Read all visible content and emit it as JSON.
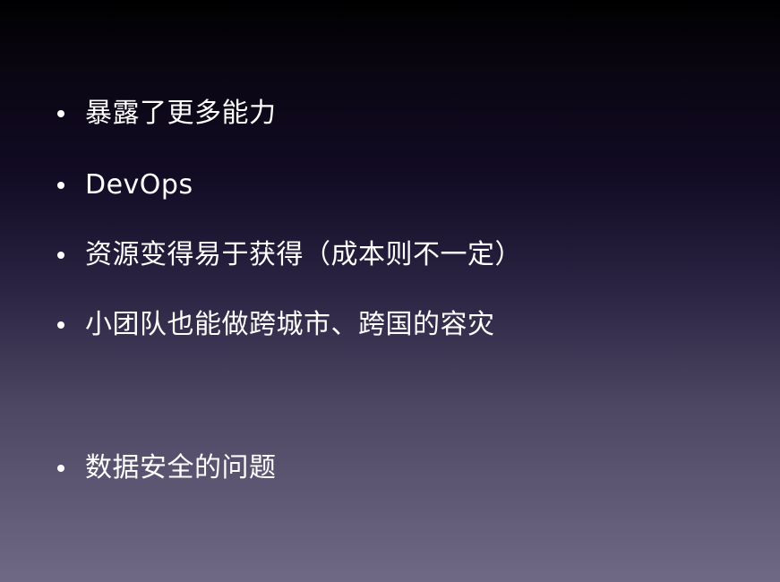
{
  "slide": {
    "bullets": [
      "暴露了更多能力",
      "DevOps",
      "资源变得易于获得（成本则不一定）",
      "小团队也能做跨城市、跨国的容灾",
      "数据安全的问题"
    ]
  },
  "colors": {
    "text": "#ffffff",
    "background_top": "#000000",
    "background_bottom": "#6f6986"
  }
}
